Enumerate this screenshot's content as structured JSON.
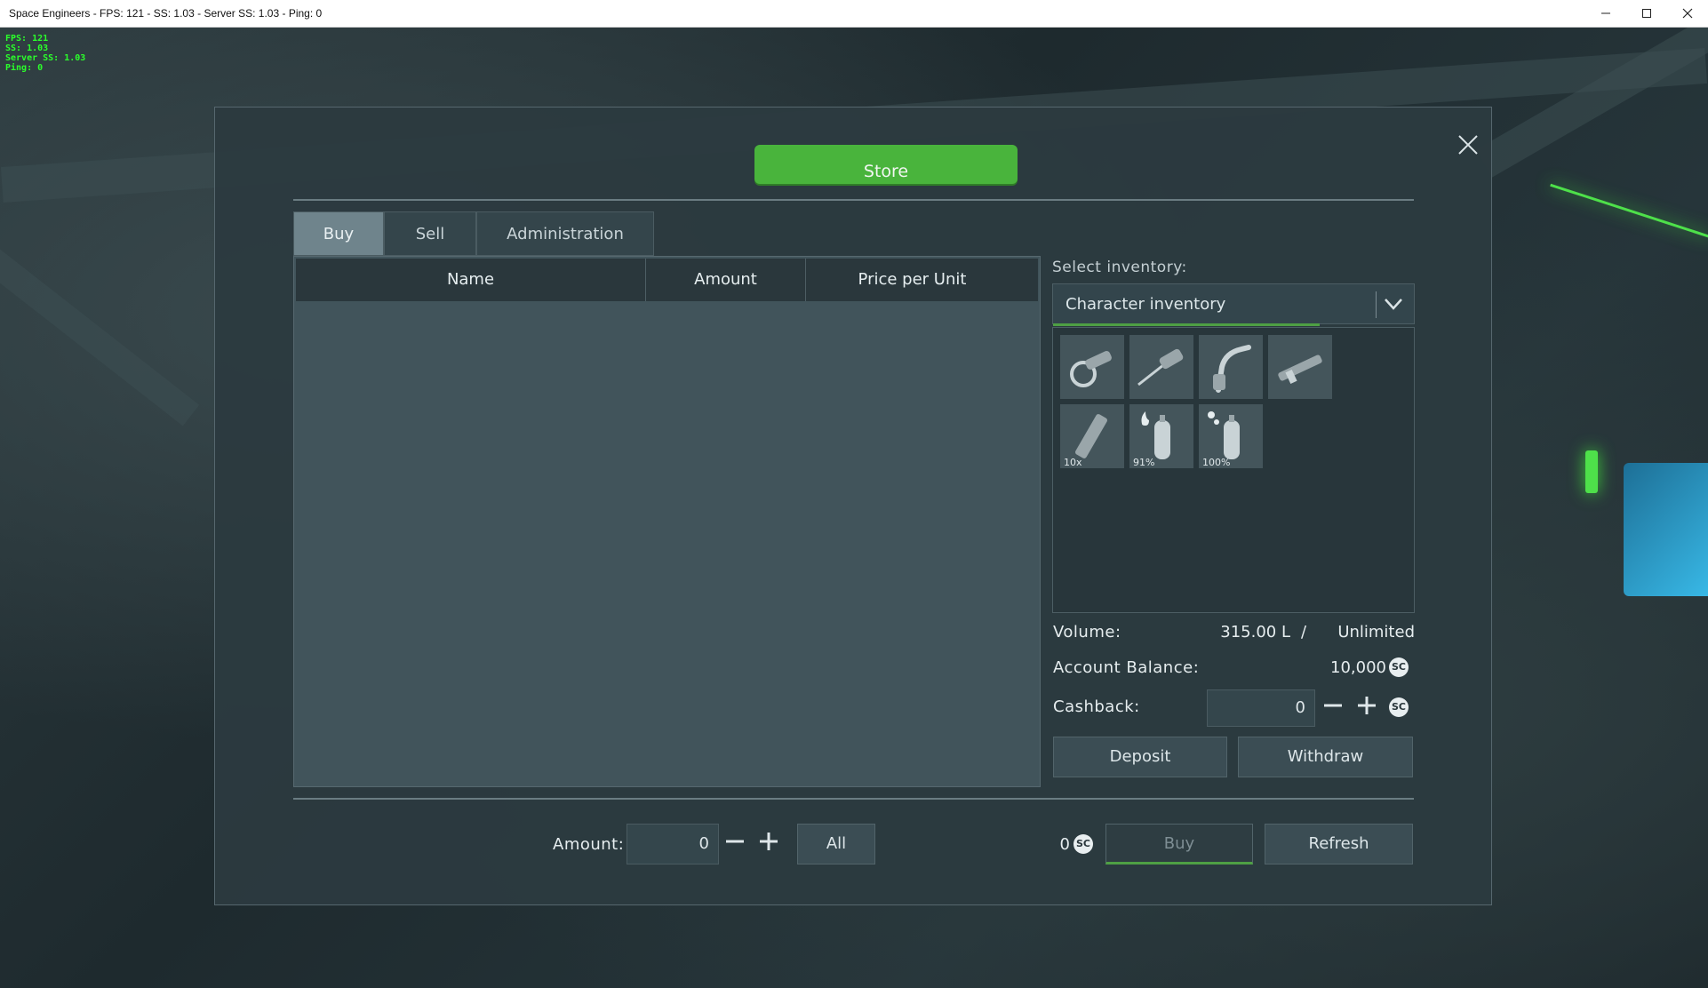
{
  "window": {
    "title": "Space Engineers - FPS: 121 - SS: 1.03 - Server SS: 1.03 - Ping: 0"
  },
  "overlay": {
    "fps": "FPS: 121",
    "ss": "SS: 1.03",
    "server_ss": "Server SS: 1.03",
    "ping": "Ping: 0"
  },
  "store": {
    "title": "Store",
    "tabs": [
      {
        "label": "Buy",
        "active": true
      },
      {
        "label": "Sell",
        "active": false
      },
      {
        "label": "Administration",
        "active": false
      }
    ],
    "table": {
      "columns": [
        "Name",
        "Amount",
        "Price per Unit"
      ],
      "rows": []
    },
    "inventory": {
      "label": "Select inventory:",
      "selected": "Character inventory",
      "items": [
        {
          "icon": "grinder-icon",
          "qty": ""
        },
        {
          "icon": "hand-drill-icon",
          "qty": ""
        },
        {
          "icon": "welder-icon",
          "qty": ""
        },
        {
          "icon": "rifle-icon",
          "qty": ""
        },
        {
          "icon": "ammo-magazine-icon",
          "qty": "10x"
        },
        {
          "icon": "hydrogen-bottle-icon",
          "qty": "91%"
        },
        {
          "icon": "oxygen-bottle-icon",
          "qty": "100%"
        }
      ]
    },
    "volume": {
      "label": "Volume:",
      "value": "315.00 L",
      "sep": "/",
      "max": "Unlimited"
    },
    "balance": {
      "label": "Account Balance:",
      "value": "10,000"
    },
    "cashback": {
      "label": "Cashback:",
      "value": "0"
    },
    "currency_symbol": "SC",
    "deposit_label": "Deposit",
    "withdraw_label": "Withdraw",
    "footer": {
      "amount_label": "Amount:",
      "amount_value": "0",
      "all_label": "All",
      "total": "0",
      "buy_label": "Buy",
      "refresh_label": "Refresh"
    }
  },
  "colors": {
    "accent": "#49b43c",
    "panel": "#2c3a40",
    "table_bg": "#41545b"
  }
}
